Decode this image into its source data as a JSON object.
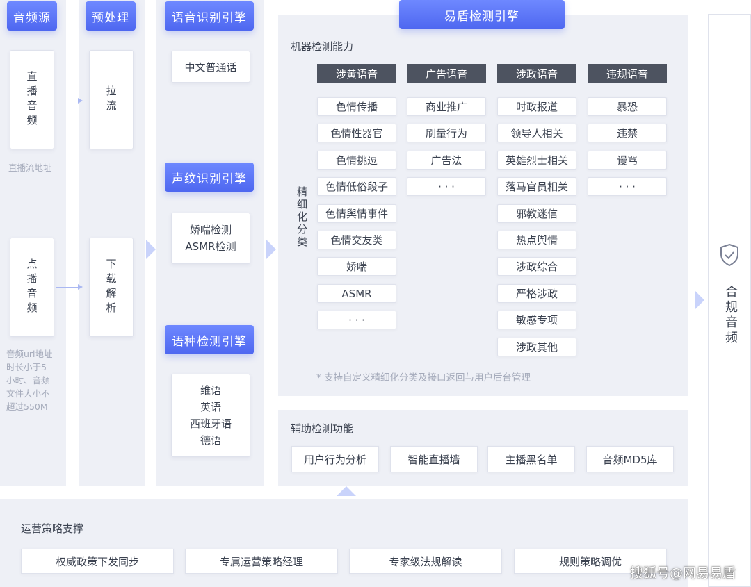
{
  "columns": {
    "audio_source": {
      "header": "音频源",
      "live_box": "直播音频",
      "live_note": "直播流地址",
      "vod_box": "点播音频",
      "vod_note": [
        "音频url地址",
        "时长小于5",
        "小时、音频",
        "文件大小不",
        "超过550M"
      ]
    },
    "preprocess": {
      "header": "预处理",
      "pull_box": "拉流",
      "download_box": "下载解析"
    },
    "engines": {
      "speech_header": "语音识别引擎",
      "speech_box": "中文普通话",
      "voiceprint_header": "声纹识别引擎",
      "voiceprint_box": [
        "娇喘检测",
        "ASMR检测"
      ],
      "language_header": "语种检测引擎",
      "language_box": [
        "维语",
        "英语",
        "西班牙语",
        "德语"
      ]
    }
  },
  "yidun": {
    "header": "易盾检测引擎",
    "machine_title": "机器检测能力",
    "fine_label": "精细化分类",
    "categories": [
      {
        "name": "涉黄语音",
        "items": [
          "色情传播",
          "色情性器官",
          "色情挑逗",
          "色情低俗段子",
          "色情舆情事件",
          "色情交友类",
          "娇喘",
          "ASMR",
          "· · ·"
        ]
      },
      {
        "name": "广告语音",
        "items": [
          "商业推广",
          "刷量行为",
          "广告法",
          "· · ·"
        ]
      },
      {
        "name": "涉政语音",
        "items": [
          "时政报道",
          "领导人相关",
          "英雄烈士相关",
          "落马官员相关",
          "邪教迷信",
          "热点舆情",
          "涉政综合",
          "严格涉政",
          "敏感专项",
          "涉政其他"
        ]
      },
      {
        "name": "违规语音",
        "items": [
          "暴恐",
          "违禁",
          "谩骂",
          "· · ·"
        ]
      }
    ],
    "footnote": "* 支持自定义精细化分类及接口返回与用户后台管理",
    "aux_title": "辅助检测功能",
    "aux_items": [
      "用户行为分析",
      "智能直播墙",
      "主播黑名单",
      "音频MD5库"
    ]
  },
  "output": {
    "label": "合规音频",
    "icon": "shield-check-icon"
  },
  "operations": {
    "title": "运营策略支撑",
    "items": [
      "权威政策下发同步",
      "专属运营策略经理",
      "专家级法规解读",
      "规则策略调优"
    ]
  },
  "watermark": "搜狐号@网易易盾",
  "colors": {
    "header_blue": "#5068f0",
    "category_dark": "#4d5360",
    "panel_bg": "#eef0f6"
  }
}
